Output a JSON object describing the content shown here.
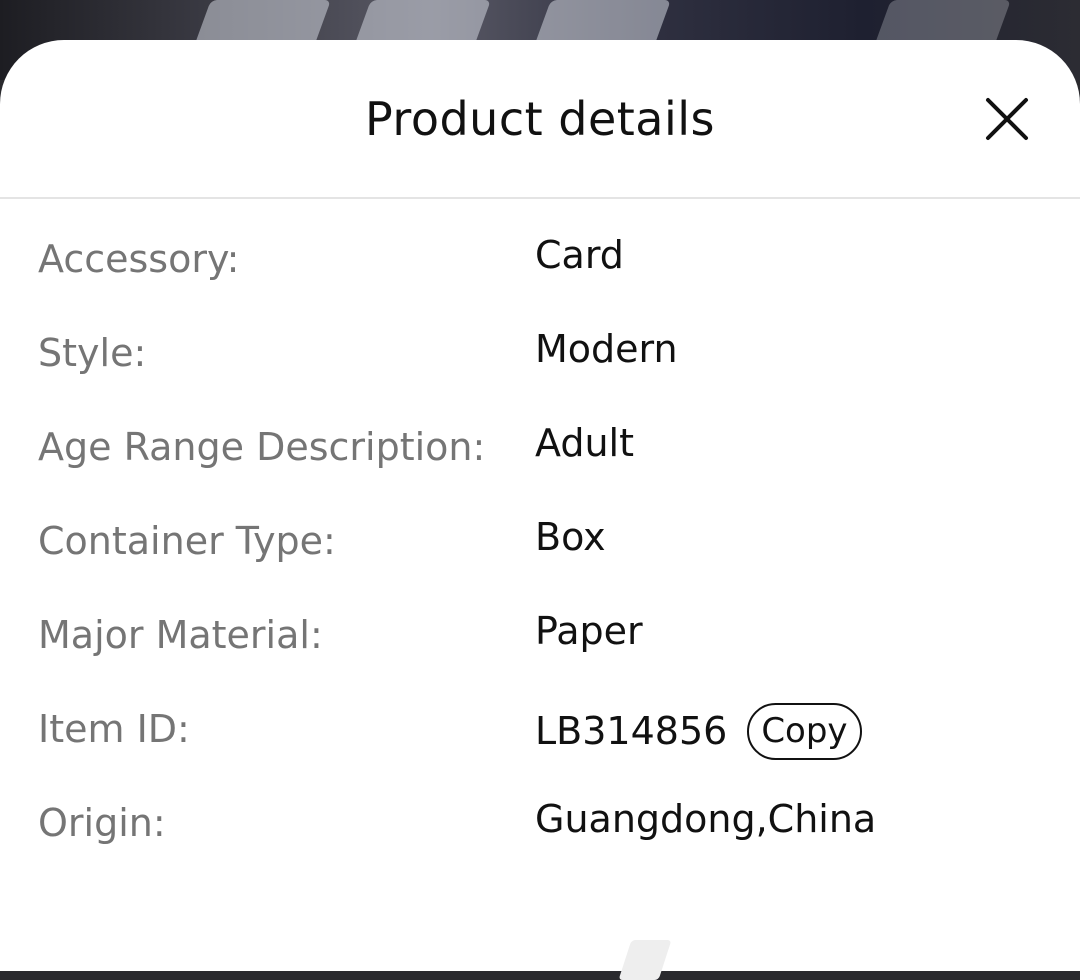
{
  "sheet": {
    "title": "Product details",
    "close_icon": "close-icon"
  },
  "details": [
    {
      "label": "Accessory:",
      "value": "Card"
    },
    {
      "label": "Style:",
      "value": "Modern"
    },
    {
      "label": "Age Range Description:",
      "value": "Adult"
    },
    {
      "label": "Container Type:",
      "value": "Box"
    },
    {
      "label": "Major Material:",
      "value": "Paper"
    },
    {
      "label": "Item ID:",
      "value": "LB314856",
      "action": "Copy"
    },
    {
      "label": "Origin:",
      "value": "Guangdong,China"
    }
  ]
}
